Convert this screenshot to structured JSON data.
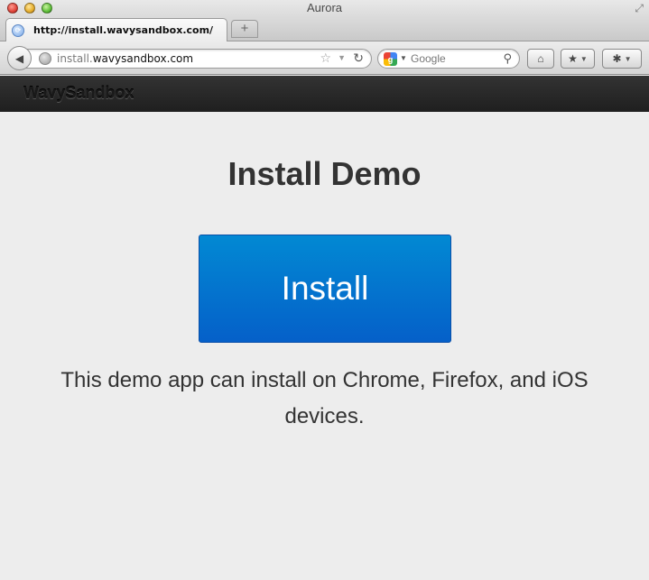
{
  "window": {
    "title": "Aurora",
    "resize_icon": "⤢"
  },
  "tab": {
    "title": "http://install.wavysandbox.com/",
    "new_tab_label": "+"
  },
  "toolbar": {
    "back_icon": "◀",
    "url_prefix": "install.",
    "url_domain": "wavysandbox.com",
    "star_icon": "☆",
    "dropdown_icon": "▼",
    "reload_icon": "↻",
    "search_engine_letter": "g",
    "search_placeholder": "Google",
    "search_icon": "⚲",
    "home_icon": "⌂",
    "bookmarks_icon": "★",
    "addon_icon": "✱",
    "menu_arrow": "▼"
  },
  "site": {
    "brand": "WavySandbox"
  },
  "main": {
    "title": "Install Demo",
    "install_label": "Install",
    "description": "This demo app can install on Chrome, Firefox, and iOS devices."
  },
  "colors": {
    "button_top": "#0289d3",
    "button_bottom": "#0560c9",
    "header": "#222222",
    "page_bg": "#ededed"
  }
}
